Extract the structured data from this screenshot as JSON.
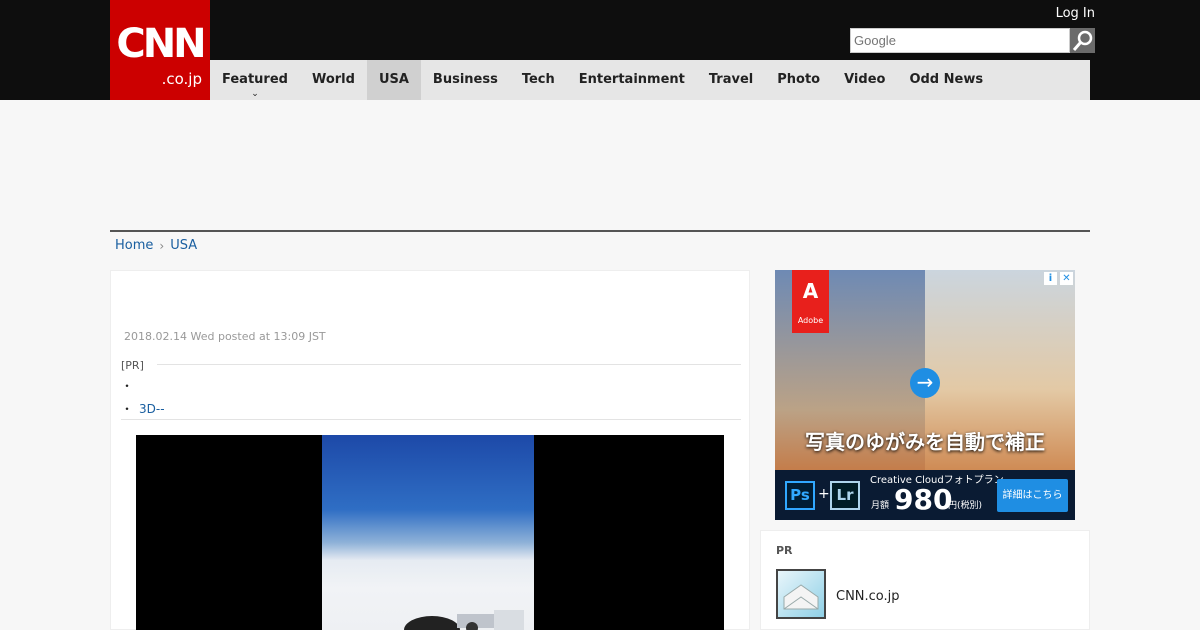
{
  "header": {
    "logo_main": "CNN",
    "logo_sub": ".co.jp",
    "login_label": "Log In",
    "search_placeholder": "Google"
  },
  "nav": {
    "items": [
      {
        "label": "Featured"
      },
      {
        "label": "World"
      },
      {
        "label": "USA"
      },
      {
        "label": "Business"
      },
      {
        "label": "Tech"
      },
      {
        "label": "Entertainment"
      },
      {
        "label": "Travel"
      },
      {
        "label": "Photo"
      },
      {
        "label": "Video"
      },
      {
        "label": "Odd News"
      }
    ],
    "active": "USA",
    "dropdown_glyph": "⌄"
  },
  "breadcrumb": {
    "home": "Home",
    "separator": "›",
    "current": "USA"
  },
  "article": {
    "dateline": "2018.02.14 Wed posted at 13:09 JST",
    "pr_label": "[PR]",
    "pr_items": [
      {
        "bullet": "・",
        "text": ""
      },
      {
        "bullet": "・",
        "text": "3D--"
      }
    ]
  },
  "ad": {
    "brand": "Adobe",
    "brand_glyph": "A",
    "headline": "写真のゆがみを自動で補正",
    "arrow_glyph": "→",
    "ps": "Ps",
    "plus": "+",
    "lr": "Lr",
    "plan": "Creative Cloudフォトプラン",
    "price_label": "月額",
    "price": "980",
    "price_unit": "円(税別)",
    "cta": "詳細はこちら",
    "info_glyph": "i",
    "close_glyph": "✕"
  },
  "pr_box": {
    "label": "PR",
    "item_text": "CNN.co.jp"
  },
  "colors": {
    "brand_red": "#cc0000",
    "link_blue": "#1a5fa0",
    "topbar": "#0e0e0e"
  }
}
